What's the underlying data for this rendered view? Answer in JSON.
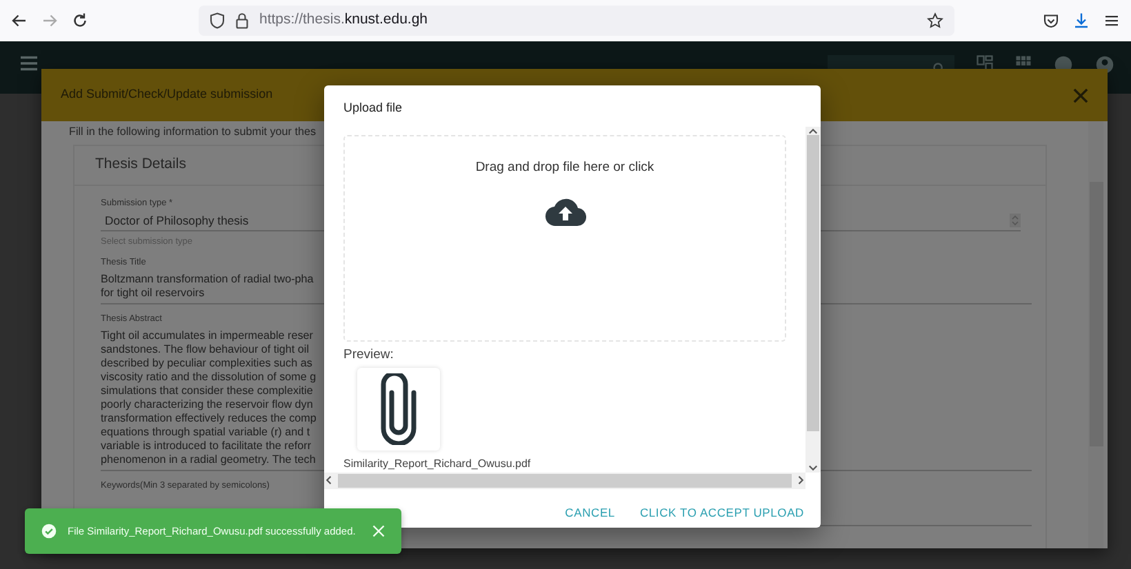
{
  "browser": {
    "url": "https://thesis.**knust.edu.gh**",
    "forward_disabled": true
  },
  "submission_dialog": {
    "title": "Add Submit/Check/Update submission",
    "intro": "Fill in the following information to submit your thes",
    "section_title": "Thesis Details",
    "fields": [
      {
        "kind": "select",
        "label": "Submission type *",
        "value_lines": [
          "Doctor of Philosophy thesis"
        ],
        "hint": "Select submission type"
      },
      {
        "kind": "text",
        "label": "Thesis Title",
        "value_lines": [
          "Boltzmann transformation of radial two-pha",
          "for tight oil reservoirs"
        ]
      },
      {
        "kind": "text",
        "label": "Thesis Abstract",
        "value_lines": [
          "Tight oil accumulates in impermeable reser",
          "sandstones. The flow behaviour of tight oil",
          "described by peculiar complexities such as",
          "viscosity ratio and the dissolution of some g",
          "simulations that consider these complexitie",
          "poorly characterizing the reservoir flow dyn",
          "transformation effectively reduces the comp",
          "equations through spatial variable (r) and t",
          "variable is introduced to facilitate the reforr",
          "phenomenon in a radial geometry. The tech"
        ]
      },
      {
        "kind": "text",
        "label": "Keywords(Min 3 separated by semicolons)"
      }
    ]
  },
  "upload_dialog": {
    "title": "Upload file",
    "dropzone_text": "Drag and drop file here or click",
    "preview_label": "Preview:",
    "files": [
      {
        "name": "Similarity_Report_Richard_Owusu.pdf"
      }
    ],
    "buttons": [
      "CANCEL",
      "CLICK TO ACCEPT UPLOAD"
    ]
  },
  "toast": {
    "message": "File Similarity_Report_Richard_Owusu.pdf successfully added."
  }
}
